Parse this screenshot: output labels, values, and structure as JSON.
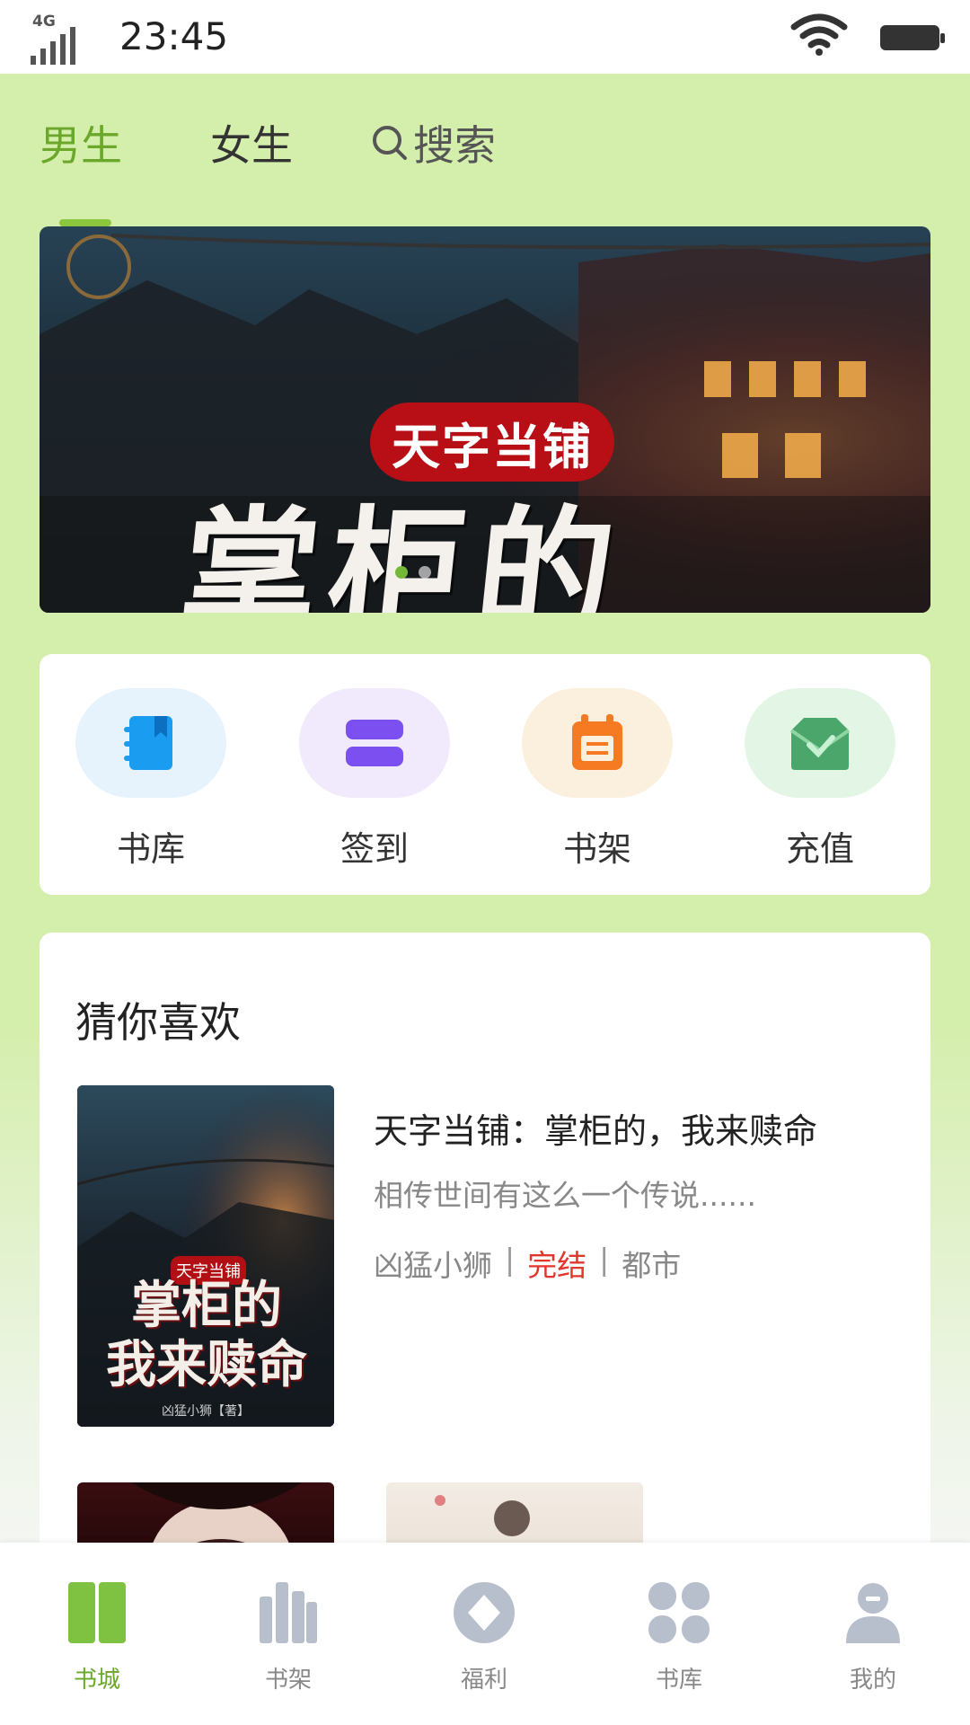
{
  "status_bar": {
    "network": "4G",
    "time": "23:45"
  },
  "top_tabs": {
    "male": "男生",
    "female": "女生",
    "search": "搜索",
    "active": "male"
  },
  "banner": {
    "badge": "天字当铺",
    "title": "掌柜的"
  },
  "quick_actions": [
    {
      "label": "书库",
      "icon": "book-icon",
      "color": "#1a9cf0",
      "bg": "#e6f3fd"
    },
    {
      "label": "签到",
      "icon": "checkin-icon",
      "color": "#7b4ff0",
      "bg": "#f1e9fc"
    },
    {
      "label": "书架",
      "icon": "calendar-icon",
      "color": "#f57a22",
      "bg": "#fbefdd"
    },
    {
      "label": "充值",
      "icon": "recharge-icon",
      "color": "#4aa66a",
      "bg": "#e3f6e6"
    }
  ],
  "recommend": {
    "title": "猜你喜欢",
    "book": {
      "name": "天字当铺：掌柜的，我来赎命",
      "desc": "相传世间有这么一个传说......",
      "author": "凶猛小狮",
      "status": "完结",
      "category": "都市",
      "separator": "|",
      "cover_badge": "天字当铺",
      "cover_title_line1": "掌柜的",
      "cover_title_line2": "我来赎命",
      "cover_author": "凶猛小狮【著】"
    }
  },
  "bottom_nav": [
    {
      "label": "书城",
      "icon": "store-icon",
      "active": true
    },
    {
      "label": "书架",
      "icon": "shelf-icon",
      "active": false
    },
    {
      "label": "福利",
      "icon": "welfare-icon",
      "active": false
    },
    {
      "label": "书库",
      "icon": "library-icon",
      "active": false
    },
    {
      "label": "我的",
      "icon": "profile-icon",
      "active": false
    }
  ],
  "colors": {
    "accent": "#6ba72a",
    "background": "#d4eeab",
    "status_red": "#e2352b"
  }
}
